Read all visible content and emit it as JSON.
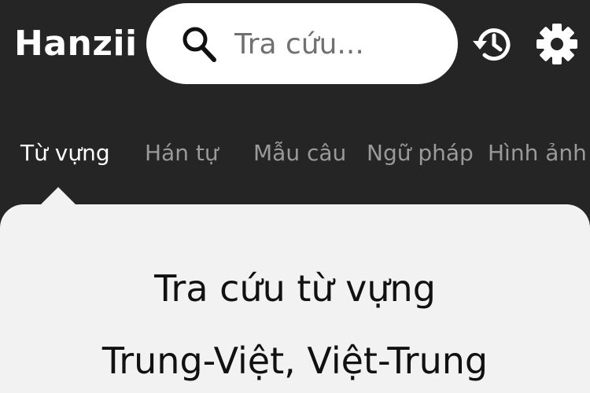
{
  "header": {
    "logo": "Hanzii",
    "search": {
      "placeholder": "Tra cứu..."
    },
    "icons": {
      "search": "search-icon",
      "history": "history-icon",
      "settings": "gear-icon"
    }
  },
  "tabs": [
    {
      "label": "Từ vựng",
      "active": true
    },
    {
      "label": "Hán tự",
      "active": false
    },
    {
      "label": "Mẫu câu",
      "active": false
    },
    {
      "label": "Ngữ pháp",
      "active": false
    },
    {
      "label": "Hình ảnh",
      "active": false
    }
  ],
  "card": {
    "title": "Tra cứu từ vựng",
    "subtitle": "Trung-Việt, Việt-Trung"
  },
  "colors": {
    "background": "#252525",
    "card": "#f2f2f2",
    "tab_inactive": "#9a9a9a",
    "tab_active": "#ffffff"
  }
}
